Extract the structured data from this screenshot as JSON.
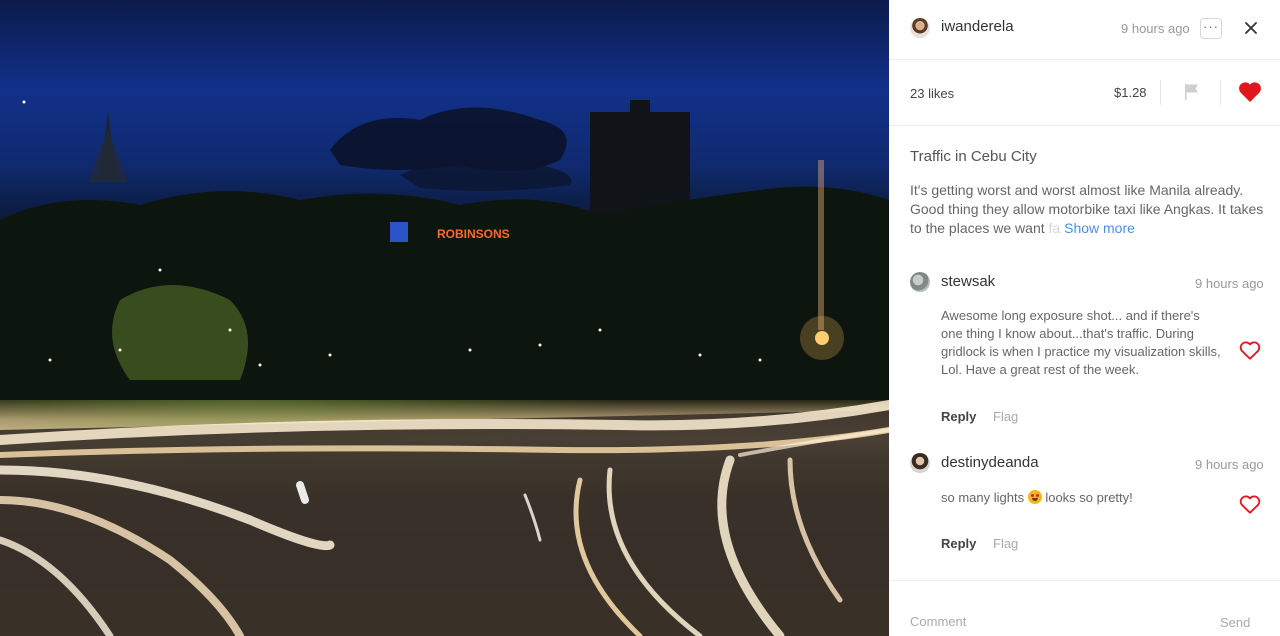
{
  "post": {
    "username": "iwanderela",
    "time": "9 hours ago",
    "more_label": "···",
    "likes": "23 likes",
    "payout": "$1.28",
    "liked": true,
    "title": "Traffic in Cebu City",
    "description_visible": "It's getting worst and worst almost like Manila already. Good thing they allow motorbike taxi like Angkas. It takes to the places we want",
    "description_faded": " fa",
    "show_more": "Show more"
  },
  "photo": {
    "sign_text": "ROBINSONS"
  },
  "comments": [
    {
      "username": "stewsak",
      "time": "9 hours ago",
      "body": "Awesome long exposure shot... and if there's one thing I know about...that's traffic. During gridlock is when I practice my visualization skills, Lol. Have a great rest of the week.",
      "reply_label": "Reply",
      "flag_label": "Flag",
      "liked": false
    },
    {
      "username": "destinydeanda",
      "time": "9 hours ago",
      "body_before_emoji": "so many lights",
      "body_after_emoji": " looks so pretty!",
      "emoji": "star-struck",
      "reply_label": "Reply",
      "flag_label": "Flag",
      "liked": false
    }
  ],
  "composer": {
    "placeholder": "Comment",
    "send_label": "Send"
  },
  "colors": {
    "accent_red": "#e0161f",
    "link_blue": "#4a90e2"
  },
  "icons": {
    "close": "close-icon",
    "flag": "flag-icon",
    "heart": "heart-icon",
    "more": "more-icon"
  }
}
